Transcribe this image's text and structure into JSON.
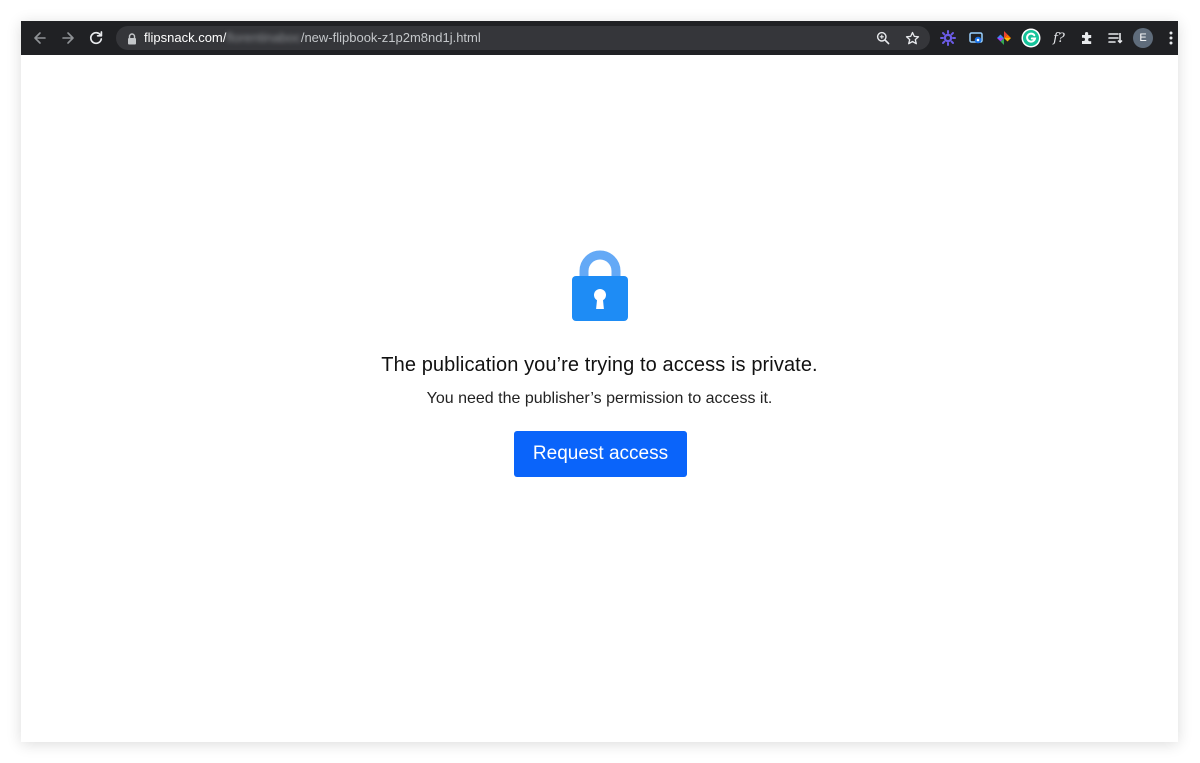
{
  "browser": {
    "url_host": "flipsnack.com/",
    "url_blurred": "florentinaboc",
    "url_path": "/new-flipbook-z1p2m8nd1j.html",
    "profile_initial": "E",
    "ext_f_label": "f?"
  },
  "page": {
    "title": "The publication you’re trying to access is private.",
    "subtitle": "You need the publisher’s permission to access it.",
    "request_button_label": "Request access"
  },
  "colors": {
    "toolbar_bg": "#202124",
    "omnibox_bg": "#35363a",
    "lock_blue": "#1e8cf5",
    "button_blue": "#0a64fa"
  },
  "icons": [
    "back-icon",
    "forward-icon",
    "reload-icon",
    "lock-icon",
    "zoom-icon",
    "star-icon",
    "puzzle-icon",
    "reading-list-icon",
    "more-icon",
    "padlock-icon"
  ]
}
